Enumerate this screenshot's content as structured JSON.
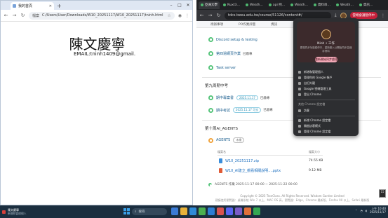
{
  "left_window": {
    "tab_title": "我的首頁",
    "url": "C:/Users/User/Downloads/W10_20251117/W10_20251117/tninh.html",
    "url_chip": "檔案",
    "page": {
      "name": "陳文慶寧",
      "email": "EMAIL:tninh1409@gmail."
    }
  },
  "right_window": {
    "tabs": [
      "亞洲大學",
      "Nuxt3…",
      "Weath…",
      "api 例…",
      "Weath…",
      "資料串…",
      "Weath…",
      "資訊…"
    ],
    "url": "tdcs.tweu.edu.tw/course/51126/content#/",
    "pause_label": "雲端會議暫停中",
    "subtabs": [
      "待辦事項",
      "PO作業評量",
      "資訊"
    ],
    "activities": [
      {
        "title": "Discord setup & testing",
        "status": ""
      },
      {
        "title": "第四週網頁作業",
        "status": "已繳專"
      },
      {
        "title": "Task server",
        "status": ""
      },
      {
        "title": "期中專案書",
        "status": "已繳專",
        "pill": "2025.11.17"
      },
      {
        "title": "期中考試",
        "status": "已繳專",
        "pill": "2025.11.17 可交"
      }
    ],
    "sections": {
      "midterm": "第九周期中考",
      "agents": "第十周AI_AGENTS"
    },
    "agents_item": {
      "label": "AGENTS",
      "pill": "未繳",
      "table_header_name": "檔案名",
      "table_header_size": "檔案大小",
      "files": [
        {
          "name": "W10_20251117.zip",
          "size": "74.55 KB",
          "type": "zip"
        },
        {
          "name": "W10_AI建立_觀看相關說明….pptx",
          "size": "9.12 MB",
          "type": "ppt"
        }
      ],
      "footer_line": "AGENTS 作業  2025-11-17 00:00 ~ 2025-11-22 00:00"
    },
    "copyright": "Copyright © 2025 TronClass. All Rights Reserved. Wisdom Garden Limited",
    "subfooter": "建議使用瀏覽器：桌機系統 Win 7 以上、MAC OS 高，瀏覽器：Edge、Chrome 最新版、Firefox 90 以上、Safari 最新版",
    "profile_popup": {
      "name": "Ninh • 工作",
      "message": "雲端同步功能暫停中，重新登入以開始同步並儲存資料",
      "button": "重新開始同步處理",
      "menu_items": [
        "新增和管理個人",
        "管理你的 Google 帳戶",
        "自訂外觀",
        "Google 密碼管理工具",
        "登出 Chrome"
      ],
      "other_label": "其他 Chrome 設定檔",
      "guest": "訪客",
      "profiles_items": [
        "新增 Chrome 設定檔",
        "開啟訪客模式",
        "管理 Chrome 設定檔"
      ]
    },
    "side_badge": "15"
  },
  "taskbar": {
    "notification_title": "陳文慶寧",
    "notification_text": "新增和管理個人",
    "search_placeholder": "搜尋",
    "time": "上午 10:40",
    "date": "2025/11/17",
    "colors": {
      "bar": "#1b2e3f",
      "accent": "#3aa0e8"
    }
  }
}
